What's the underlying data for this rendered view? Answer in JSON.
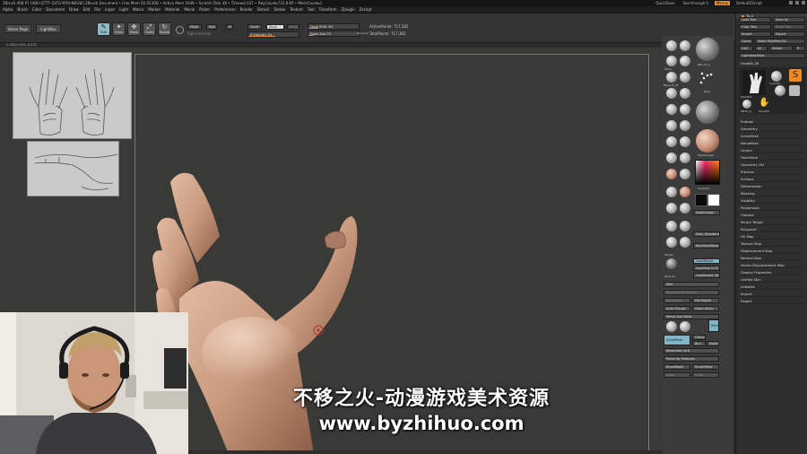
{
  "titlebar": {
    "title": "ZBrush 4R8 P1  [VBU-Q7TF-QLTG-YRRI-NKGW]    ZBrush Document    • Free Mem 56.923GB • Active Mem 1648 • Scratch Disk 48 • Timer▸0.037 • PolyCount▸722.8 KP • MeshCount▸1",
    "quicksave": "QuickSave",
    "see_through": "See-through  0",
    "menus": "Menus",
    "default_zscript": "DefaultZScript"
  },
  "menubar": {
    "items": [
      "Alpha",
      "Brush",
      "Color",
      "Document",
      "Draw",
      "Edit",
      "File",
      "Layer",
      "Light",
      "Macro",
      "Marker",
      "Material",
      "Movie",
      "Picker",
      "Preferences",
      "Render",
      "Stencil",
      "Stroke",
      "Texture",
      "Tool",
      "Transform",
      "Zplugin",
      "Zscript"
    ]
  },
  "shelf": {
    "home_page": "Home Page",
    "lightbox": "LightBox",
    "modes": [
      {
        "label": "Edit",
        "glyph": "✎",
        "active": true
      },
      {
        "label": "Draw",
        "glyph": "✦",
        "active": false
      },
      {
        "label": "Move",
        "glyph": "✥",
        "active": false
      },
      {
        "label": "Scale",
        "glyph": "⤢",
        "active": false
      },
      {
        "label": "Rotate",
        "glyph": "↻",
        "active": false
      }
    ],
    "mrgb": "Mrgb",
    "rgb": "Rgb",
    "m": "M",
    "rgb_intensity": "Rgb Intensity",
    "zadd": "Zadd",
    "zsub": "Zsub",
    "zcut": "Zcut",
    "z_intensity": "Z Intensity  54",
    "focal_shift": "Focal Shift  -63",
    "draw_size": "Draw Size  53",
    "dynamic": "Dynamic",
    "active_points": "ActivePoints: 717,362",
    "total_points": "TotalPoints: 717,362"
  },
  "infobar": {
    "text": "-0.453,0.009,-0.232"
  },
  "toolstrip": {
    "labels": [
      "DEC bt_A",
      "Move",
      "Move To_M",
      "ClayBuild",
      "Dam_Standard",
      "Inflat",
      "Standard",
      "TrimDynamic",
      "hPolish",
      "ClayTubes",
      "Pinch",
      "SnakeHook",
      "ZModeler",
      "Curve",
      "Smooth",
      "Slice",
      "Alpha Off",
      "Texture Off",
      "SkinShade4",
      "Gradient",
      "SwitchColor",
      "Alternate",
      "Dots",
      "Stroke",
      "BackfaceMask",
      "LazyMouse",
      "LazyStep 0.05",
      "LazyRadius 36",
      "Sdiv",
      "Del Lower",
      "Del Higher",
      "Reconstruct Subdiv",
      "Auto Groups",
      "Close Holes",
      "Mirror And Weld",
      "Groups",
      "Polish",
      "Blur",
      "Projection",
      "DynaMesh",
      "Resolution 616",
      "Polish By Features",
      "ZRemesher",
      "Target Polygons Count 5",
      "BrushMask",
      "SmartMask",
      "Clear",
      "Grow",
      "Save As"
    ]
  },
  "tool_panel": {
    "title": "Tool",
    "load_tool": "Load Tool",
    "save_as": "Save As",
    "copy_tool": "Copy Tool",
    "paste_tool": "Paste Tool",
    "import": "Import",
    "export": "Export",
    "clone": "Clone",
    "make_polymesh": "Make PolyMesh3D",
    "goz": "GoZ",
    "all": "All",
    "visible": "Visible",
    "r": "R",
    "lightbox_tools": "Lightbox▸Tools",
    "handkit": "HandKit_58",
    "subtools_thumbs": [
      "HandKit",
      "Cylinder",
      "Sphere",
      "PolyMesh3D",
      "SimpleBrush",
      "PM3D_S_",
      "HandKit"
    ],
    "sections": [
      "Subtool",
      "Geometry",
      "ArrayMesh",
      "NanoMesh",
      "Layers",
      "FiberMesh",
      "Geometry HD",
      "Preview",
      "Surface",
      "Deformation",
      "Masking",
      "Visibility",
      "Polygroups",
      "Contact",
      "Morph Target",
      "Polypaint",
      "UV Map",
      "Texture Map",
      "Displacement Map",
      "Normal Map",
      "Vector Displacement Map",
      "Display Properties",
      "Unified Skin",
      "Initialize",
      "Import",
      "Export"
    ]
  },
  "watermark": {
    "line1": "不移之火-动漫游戏美术资源",
    "line2": "www.byzhihuo.com"
  },
  "colors": {
    "accent": "#f08a24",
    "canvas": "#393936",
    "active_mode": "#8fb9c6",
    "skin": "#c9997e"
  }
}
